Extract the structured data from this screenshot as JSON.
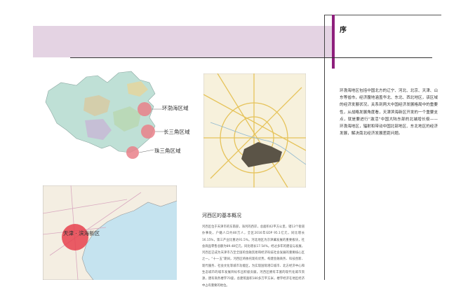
{
  "section": {
    "title": "序"
  },
  "intro_text": "环渤海地区包括中国北方的辽宁、河北、北京、天津、山东等省市，经济腹地涵盖华北、东北、西北地区，该区域的经济发展状况，关系到两大中国经济发展格局中的重要性，从战略发展角度看，天津滨海新区开发的一个重要支点，就是要进行“激活”中国大陆东部的北端增长极——环渤海地区，辐射和带动中国北部地区、东北地区的经济发展，解决南北经济发展差距问题。",
  "map1": {
    "labels": [
      "环渤海区域",
      "长三角区域",
      "珠三角区域"
    ],
    "colors": {
      "circle": "#e9808a",
      "land": "#bfe0d6"
    }
  },
  "map2": {
    "colors": {
      "district": "#5b5447",
      "roads": "#e6c35a"
    }
  },
  "map3": {
    "label": "天津 · 滨海新区",
    "colors": {
      "circle": "#e6414e",
      "sea": "#c5e3ef"
    }
  },
  "subsection": {
    "title": "河西区的基本概况",
    "body": "河西区位于天津市的东南部，海河的西岸，总面积42平方公里，辖13个街道办事处，户籍人口约80万人，全区2016年GDP 95.1亿元，同比增长16.15%，第三产业比重达91.5%。河北地区为京津冀发展的重要板块，社会商品零售总额为89.48亿元，同比增长17.54%。经过多年的建设与发展，河西区已成为天津市乃至全国的金融贸易和经济科技社会发展的重要核心区之一。“十一五”期间，河西区将依托现有优势，构建金融商务、科技创新、现代服务、社会文化等城市功能区，为实现国际港口城市、北方经济中心和生态城市的城市发展目标作出积极贡献。河西区拥有丰富的现代化城市资源，建有商务楼宇70座，总建筑面积180多万平方米，楼宇经济在地区经济中占有重要的地位。"
  }
}
